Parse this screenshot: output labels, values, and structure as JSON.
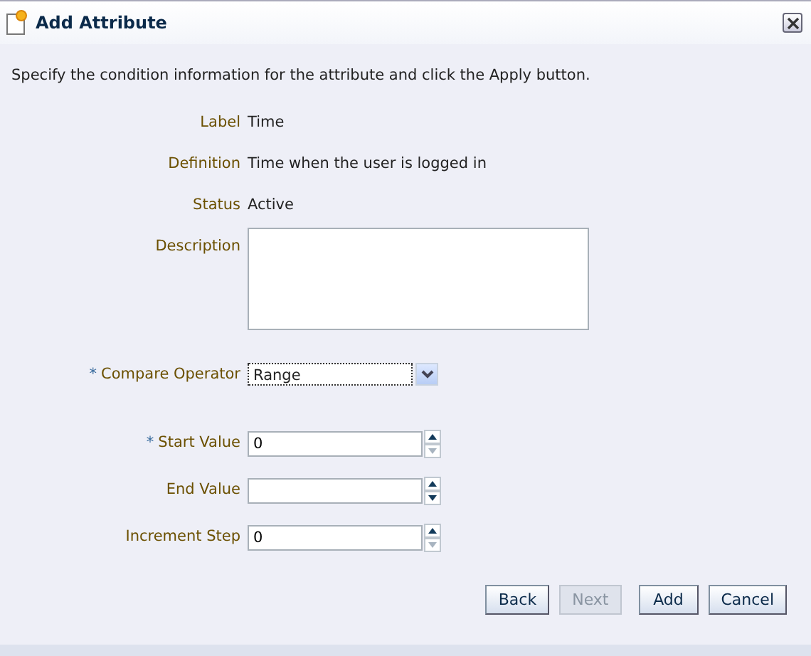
{
  "dialog": {
    "title": "Add Attribute",
    "instructions": "Specify the condition information for the attribute and click the Apply button."
  },
  "fields": [
    {
      "kind": "text",
      "label": "Label",
      "value": "Time"
    },
    {
      "kind": "text",
      "label": "Definition",
      "value": "Time when the user is logged in"
    },
    {
      "kind": "text",
      "label": "Status",
      "value": "Active"
    },
    {
      "kind": "textarea",
      "label": "Description"
    },
    {
      "kind": "select",
      "label": "Compare Operator",
      "required_mark": "*",
      "value": "Range"
    },
    {
      "kind": "spinner",
      "label": "Start Value",
      "required_mark": "*",
      "value": "0",
      "down_disabled": true
    },
    {
      "kind": "spinner",
      "label": "End Value",
      "down_disabled": false
    },
    {
      "kind": "spinner",
      "label": "Increment Step",
      "value": "0",
      "down_disabled": true
    }
  ],
  "buttons": [
    {
      "label": "Back",
      "disabled": false
    },
    {
      "label": "Next",
      "disabled": true
    },
    {
      "label": "Add",
      "disabled": false
    },
    {
      "label": "Cancel",
      "disabled": false
    }
  ]
}
